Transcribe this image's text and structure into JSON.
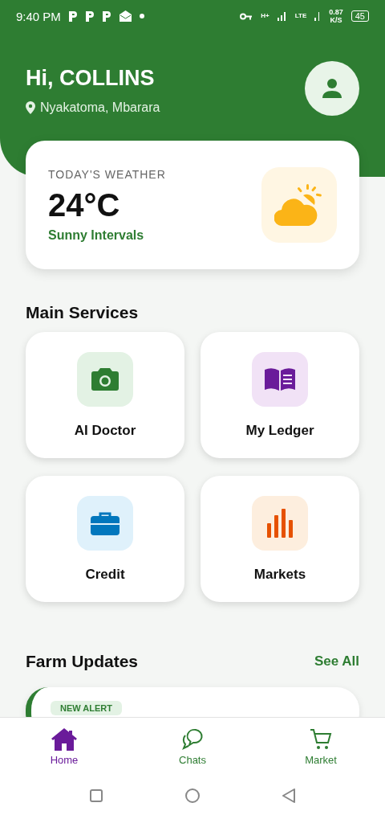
{
  "status_bar": {
    "time": "9:40 PM",
    "network": "H+",
    "network2": "LTE",
    "speed_value": "0.87",
    "speed_unit": "K/S",
    "battery": "45"
  },
  "header": {
    "greeting": "Hi, COLLINS",
    "location": "Nyakatoma, Mbarara"
  },
  "weather": {
    "label": "TODAY'S WEATHER",
    "temperature": "24°C",
    "condition": "Sunny Intervals"
  },
  "main_services": {
    "title": "Main Services",
    "items": [
      {
        "label": "AI Doctor",
        "kind": "camera",
        "color": "#2e7d32"
      },
      {
        "label": "My Ledger",
        "kind": "book",
        "color": "#6a1b9a"
      },
      {
        "label": "Credit",
        "kind": "briefcase",
        "color": "#0277bd"
      },
      {
        "label": "Markets",
        "kind": "chart",
        "color": "#e65100"
      }
    ]
  },
  "farm_updates": {
    "title": "Farm Updates",
    "see_all": "See All",
    "first_badge": "NEW ALERT"
  },
  "bottom_nav": [
    {
      "label": "Home",
      "kind": "home",
      "selected": true
    },
    {
      "label": "Chats",
      "kind": "chats",
      "selected": false
    },
    {
      "label": "Market",
      "kind": "cart",
      "selected": false
    }
  ]
}
